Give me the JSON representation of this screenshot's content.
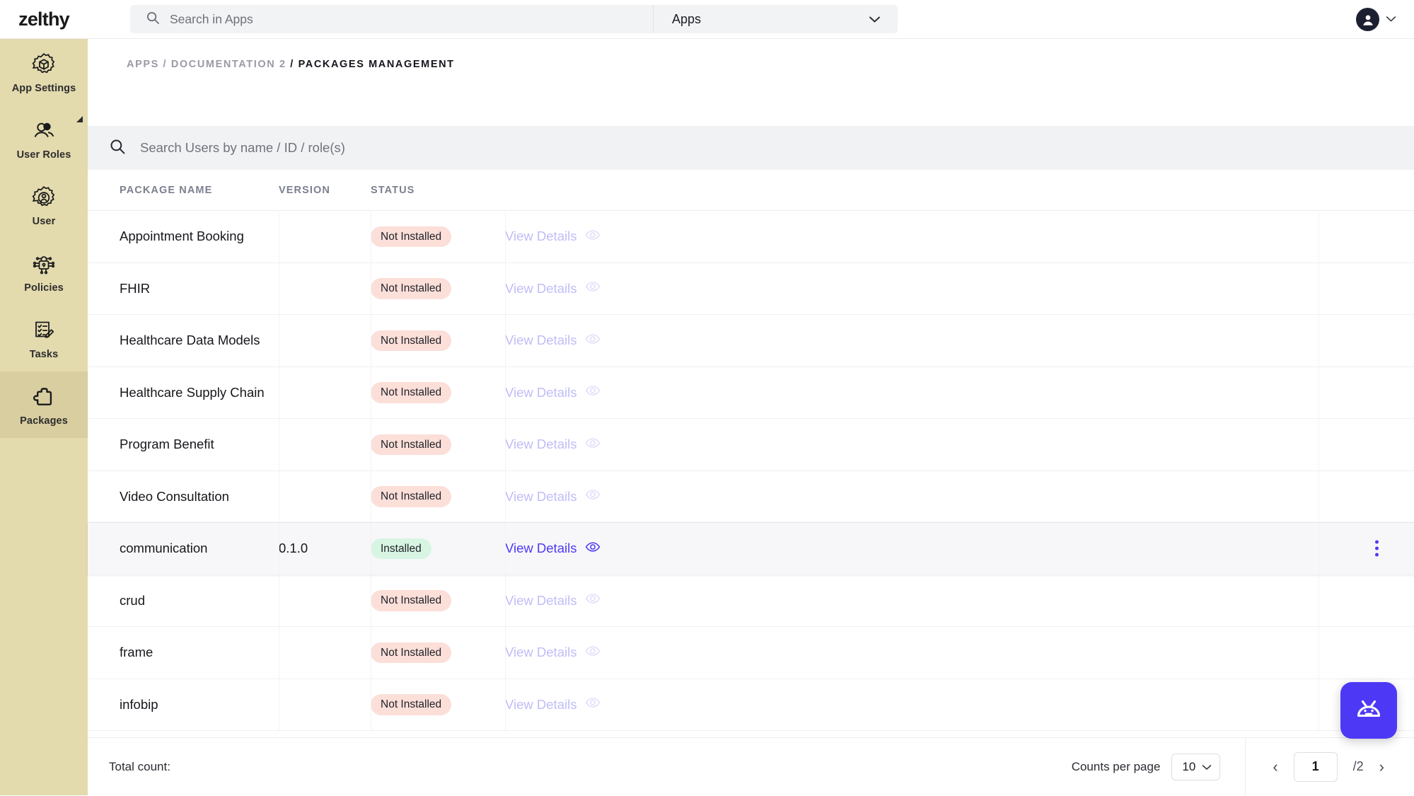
{
  "brand": {
    "name": "zelthy"
  },
  "topbar": {
    "search_placeholder": "Search in Apps",
    "search_value": "",
    "scope_label": "Apps",
    "search_icon": "search-icon",
    "chevron_icon": "chevron-down-icon",
    "avatar_icon": "account-circle-icon"
  },
  "sidebar": {
    "items": [
      {
        "label": "App Settings",
        "icon": "gear-cube-icon",
        "active": false
      },
      {
        "label": "User Roles",
        "icon": "user-roles-icon",
        "active": false
      },
      {
        "label": "User",
        "icon": "gear-user-icon",
        "active": false
      },
      {
        "label": "Policies",
        "icon": "policy-lock-icon",
        "active": false
      },
      {
        "label": "Tasks",
        "icon": "checklist-pencil-icon",
        "active": false
      },
      {
        "label": "Packages",
        "icon": "puzzle-piece-icon",
        "active": true
      }
    ]
  },
  "breadcrumb": {
    "items": [
      "APPS",
      "DOCUMENTATION 2"
    ],
    "current": "PACKAGES MANAGEMENT",
    "separator": "/"
  },
  "table": {
    "search_placeholder": "Search Users by name / ID / role(s)",
    "search_value": "",
    "search_icon": "search-icon",
    "columns": [
      "PACKAGE NAME",
      "VERSION",
      "STATUS"
    ],
    "action_label": "View Details",
    "action_icon": "eye-icon",
    "kebab_icon": "more-vertical-icon",
    "status_not_installed": "Not Installed",
    "status_installed": "Installed",
    "rows": [
      {
        "name": "Appointment Booking",
        "version": "",
        "status": "Not Installed",
        "installed": false,
        "selected": false
      },
      {
        "name": "FHIR",
        "version": "",
        "status": "Not Installed",
        "installed": false,
        "selected": false
      },
      {
        "name": "Healthcare Data Models",
        "version": "",
        "status": "Not Installed",
        "installed": false,
        "selected": false
      },
      {
        "name": "Healthcare Supply Chain",
        "version": "",
        "status": "Not Installed",
        "installed": false,
        "selected": false
      },
      {
        "name": "Program Benefit",
        "version": "",
        "status": "Not Installed",
        "installed": false,
        "selected": false
      },
      {
        "name": "Video Consultation",
        "version": "",
        "status": "Not Installed",
        "installed": false,
        "selected": false
      },
      {
        "name": "communication",
        "version": "0.1.0",
        "status": "Installed",
        "installed": true,
        "selected": true
      },
      {
        "name": "crud",
        "version": "",
        "status": "Not Installed",
        "installed": false,
        "selected": false
      },
      {
        "name": "frame",
        "version": "",
        "status": "Not Installed",
        "installed": false,
        "selected": false
      },
      {
        "name": "infobip",
        "version": "",
        "status": "Not Installed",
        "installed": false,
        "selected": false
      }
    ]
  },
  "footer": {
    "total_count_label": "Total count:",
    "total_count_value": "",
    "counts_per_page_label": "Counts per page",
    "counts_per_page_value": "10",
    "prev_icon": "chevron-left-icon",
    "next_icon": "chevron-right-icon",
    "page_current": "1",
    "page_total": "/2"
  },
  "bot": {
    "icon": "robot-face-icon"
  },
  "colors": {
    "sidebar_bg": "#e3daae",
    "sidebar_active_bg": "#d8cea0",
    "accent": "#4d39f5",
    "badge_not_installed_bg": "#fbdfd8",
    "badge_installed_bg": "#d7f5e2",
    "link_muted": "#c0bdf7"
  }
}
